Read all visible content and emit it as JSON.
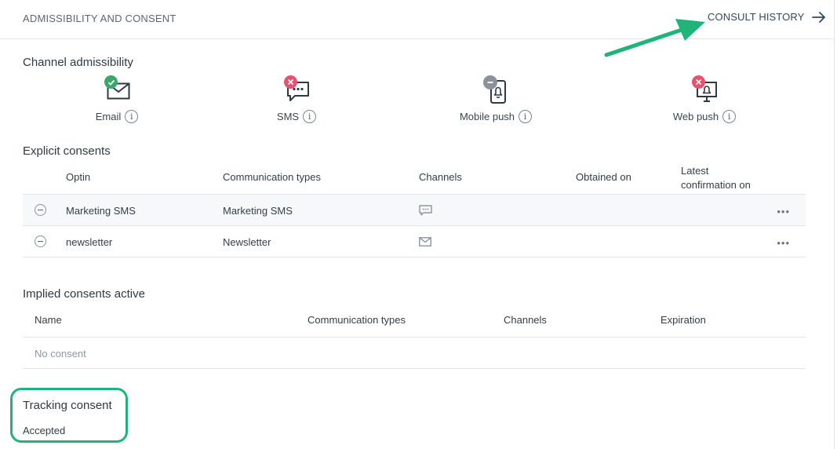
{
  "header": {
    "title": "ADMISSIBILITY AND CONSENT",
    "history_label": "CONSULT HISTORY"
  },
  "channel_admissibility": {
    "title": "Channel admissibility",
    "channels": [
      {
        "name": "Email",
        "status": "allowed",
        "icon": "envelope-icon"
      },
      {
        "name": "SMS",
        "status": "denied",
        "icon": "chat-bubble-icon"
      },
      {
        "name": "Mobile push",
        "status": "neutral",
        "icon": "mobile-bell-icon"
      },
      {
        "name": "Web push",
        "status": "denied",
        "icon": "monitor-bell-icon"
      }
    ]
  },
  "explicit_consents": {
    "title": "Explicit consents",
    "columns": [
      "Optin",
      "Communication types",
      "Channels",
      "Obtained on",
      "Latest",
      "confirmation on"
    ],
    "rows": [
      {
        "optin": "Marketing SMS",
        "comm_type": "Marketing SMS",
        "channel_icon": "chat-bubble-icon",
        "obtained_on": "",
        "latest": ""
      },
      {
        "optin": "newsletter",
        "comm_type": "Newsletter",
        "channel_icon": "envelope-icon",
        "obtained_on": "",
        "latest": ""
      }
    ],
    "more_label": "•••"
  },
  "implied_consents": {
    "title": "Implied consents active",
    "columns": [
      "Name",
      "Communication types",
      "Channels",
      "Expiration"
    ],
    "empty_label": "No consent"
  },
  "tracking_consent": {
    "title": "Tracking consent",
    "status": "Accepted"
  },
  "colors": {
    "allowed": "#3aa76d",
    "denied": "#e5546f",
    "neutral": "#8a939c",
    "annotation": "#1fb47a"
  }
}
